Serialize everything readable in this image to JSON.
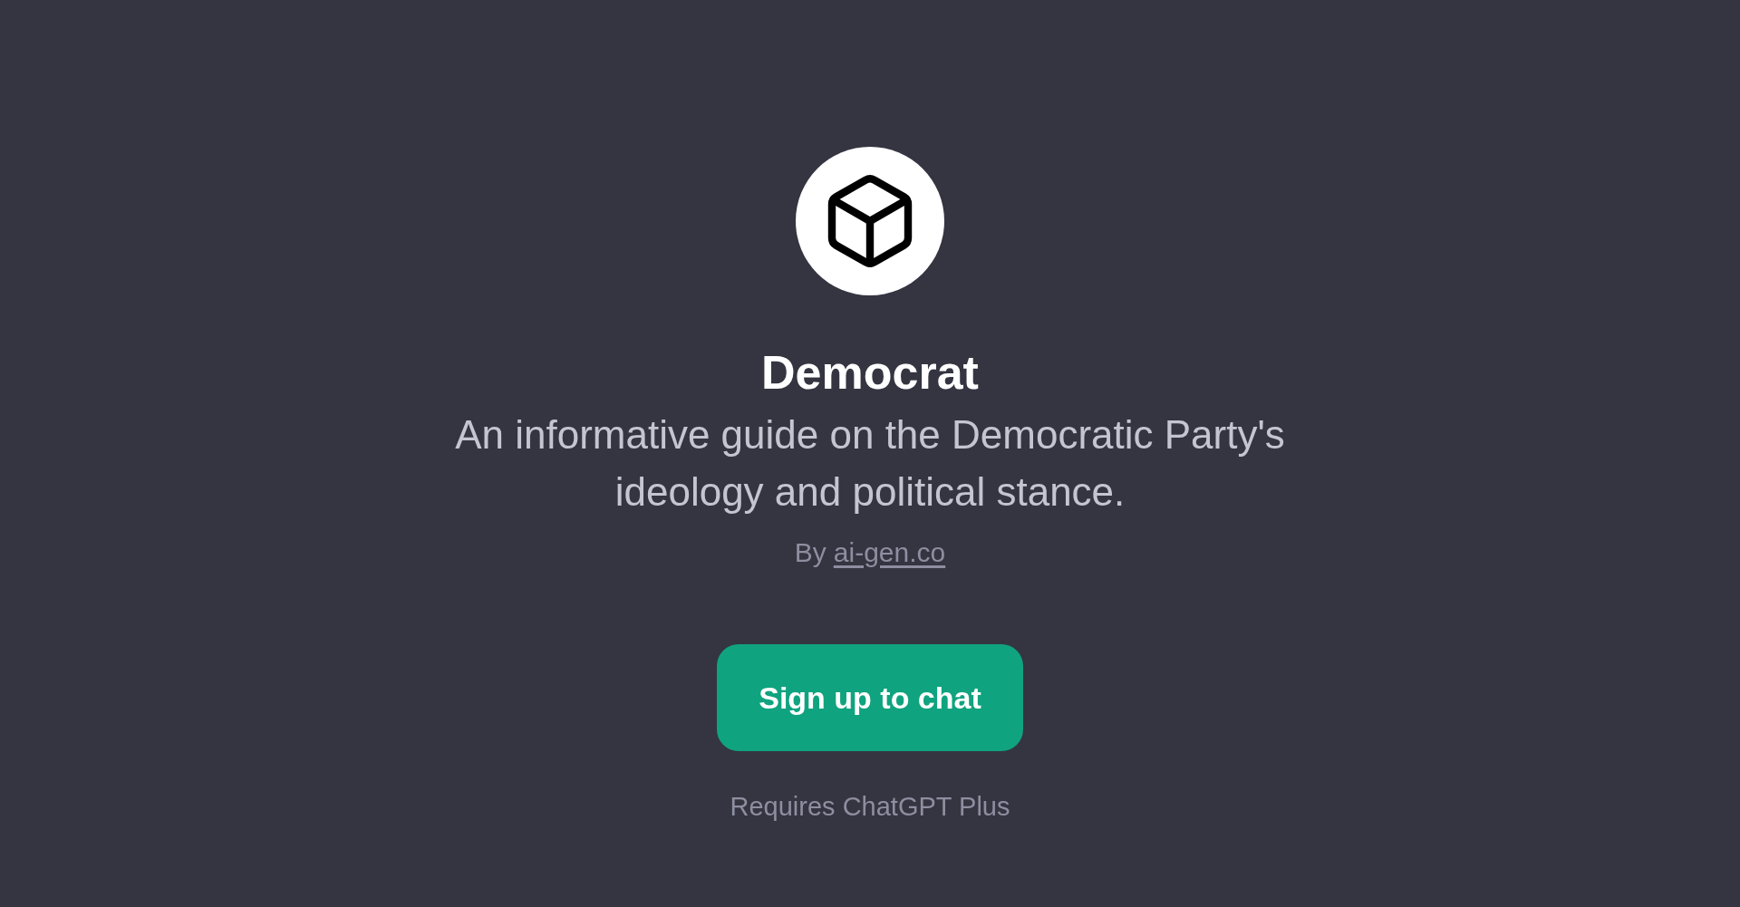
{
  "gpt": {
    "name": "Democrat",
    "description": "An informative guide on the Democratic Party's ideology and political stance.",
    "author": {
      "prefix": "By",
      "link": "ai-gen.co"
    }
  },
  "signup_button": {
    "label": "Sign up to chat"
  },
  "requirement_note": "Requires ChatGPT Plus"
}
